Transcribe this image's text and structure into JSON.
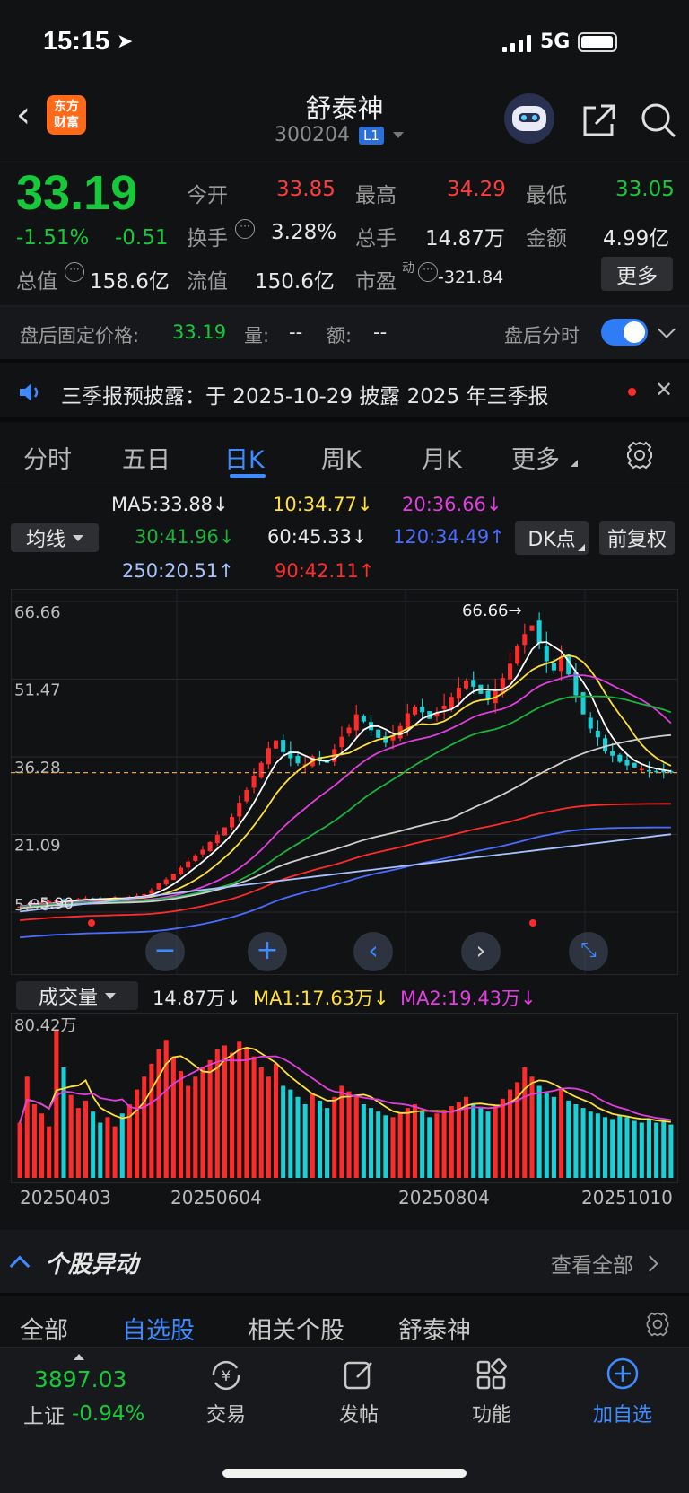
{
  "status_bar": {
    "time": "15:15",
    "network": "5G"
  },
  "header": {
    "stock_name": "舒泰神",
    "stock_code": "300204",
    "level_badge": "L1",
    "logo_text_1": "东方",
    "logo_text_2": "财富"
  },
  "quote": {
    "price": "33.19",
    "change_pct": "-1.51%",
    "change": "-0.51",
    "open_label": "今开",
    "open": "33.85",
    "high_label": "最高",
    "high": "34.29",
    "low_label": "最低",
    "low": "33.05",
    "turnover_label": "换手",
    "turnover": "3.28%",
    "volume_label": "总手",
    "volume": "14.87万",
    "amount_label": "金额",
    "amount": "4.99亿",
    "mktcap_label": "总值",
    "mktcap": "158.6亿",
    "float_label": "流值",
    "float": "150.6亿",
    "pe_label": "市盈",
    "pe_sup": "动",
    "pe": "-321.84",
    "more_label": "更多"
  },
  "after_hours": {
    "label": "盘后固定价格:",
    "price": "33.19",
    "vol_label": "量:",
    "vol": "--",
    "amt_label": "额:",
    "amt": "--",
    "toggle_label": "盘后分时",
    "toggle_on": true
  },
  "notice": {
    "text": "三季报预披露：于 2025-10-29 披露 2025 年三季报"
  },
  "chart_tabs": [
    "分时",
    "五日",
    "日K",
    "周K",
    "月K",
    "更多"
  ],
  "active_tab": "日K",
  "ma_panel": {
    "select_label": "均线",
    "ma5": "MA5:33.88↓",
    "ma10": "10:34.77↓",
    "ma20": "20:36.66↓",
    "ma30": "30:41.96↓",
    "ma60": "60:45.33↓",
    "ma120": "120:34.49↑",
    "ma250": "250:20.51↑",
    "ma90": "90:42.11↑",
    "dk_label": "DK点",
    "adjust_label": "前复权"
  },
  "volume_panel": {
    "select_label": "成交量",
    "vol": "14.87万↓",
    "ma1": "MA1:17.63万↓",
    "ma2": "MA2:19.43万↓",
    "max_label": "80.42万"
  },
  "chart_data": {
    "type": "candlestick",
    "y_ticks": [
      "66.66",
      "51.47",
      "36.28",
      "21.09",
      "5.90"
    ],
    "ylim": [
      5.9,
      66.66
    ],
    "high_marker": "66.66→",
    "low_marker": "←5.90",
    "x_ticks": [
      "20250403",
      "20250604",
      "20250804",
      "20251010"
    ],
    "current_price_line": 33.19,
    "close_series": [
      7.0,
      7.3,
      7.5,
      7.8,
      8.0,
      8.2,
      8.0,
      8.3,
      8.5,
      8.6,
      8.5,
      8.4,
      8.6,
      8.8,
      8.7,
      8.9,
      9.1,
      9.4,
      10.2,
      11.5,
      12.3,
      13.4,
      14.6,
      15.8,
      17.0,
      18.1,
      19.6,
      21.0,
      22.5,
      24.5,
      27.3,
      29.8,
      32.6,
      35.1,
      38.0,
      39.5,
      37.2,
      36.0,
      35.0,
      34.8,
      36.4,
      35.7,
      35.1,
      37.8,
      40.2,
      42.0,
      44.6,
      43.2,
      41.5,
      40.0,
      39.0,
      40.5,
      42.3,
      44.8,
      46.1,
      45.0,
      43.7,
      44.9,
      46.3,
      48.0,
      49.8,
      51.2,
      50.0,
      48.6,
      47.5,
      49.1,
      51.7,
      54.5,
      57.9,
      60.3,
      62.0,
      58.6,
      55.0,
      53.2,
      55.8,
      52.4,
      48.3,
      44.6,
      41.8,
      40.1,
      37.4,
      36.5,
      35.3,
      34.6,
      34.2,
      33.9,
      33.6,
      33.5,
      33.2,
      33.19
    ],
    "volume_series": [
      30,
      55,
      40,
      35,
      28,
      80,
      60,
      45,
      38,
      42,
      36,
      30,
      33,
      28,
      35,
      40,
      48,
      55,
      62,
      70,
      75,
      66,
      58,
      50,
      55,
      60,
      64,
      70,
      72,
      68,
      74,
      70,
      66,
      60,
      55,
      62,
      50,
      48,
      44,
      40,
      46,
      42,
      38,
      44,
      50,
      47,
      45,
      40,
      38,
      36,
      34,
      33,
      35,
      38,
      40,
      36,
      33,
      35,
      37,
      39,
      41,
      44,
      40,
      38,
      36,
      39,
      43,
      48,
      52,
      60,
      55,
      50,
      46,
      44,
      48,
      42,
      40,
      38,
      36,
      35,
      33,
      32,
      34,
      33,
      31,
      30,
      32,
      30,
      31,
      29
    ]
  },
  "stock_news": {
    "title": "个股异动",
    "view_all": "查看全部"
  },
  "bottom_tabs": {
    "items": [
      "全部",
      "自选股",
      "相关个股",
      "舒泰神"
    ],
    "active": "自选股"
  },
  "bottom_bar": {
    "index_value": "3897.03",
    "index_name": "上证",
    "index_change": "-0.94%",
    "items": [
      "交易",
      "发帖",
      "功能",
      "加自选"
    ]
  }
}
